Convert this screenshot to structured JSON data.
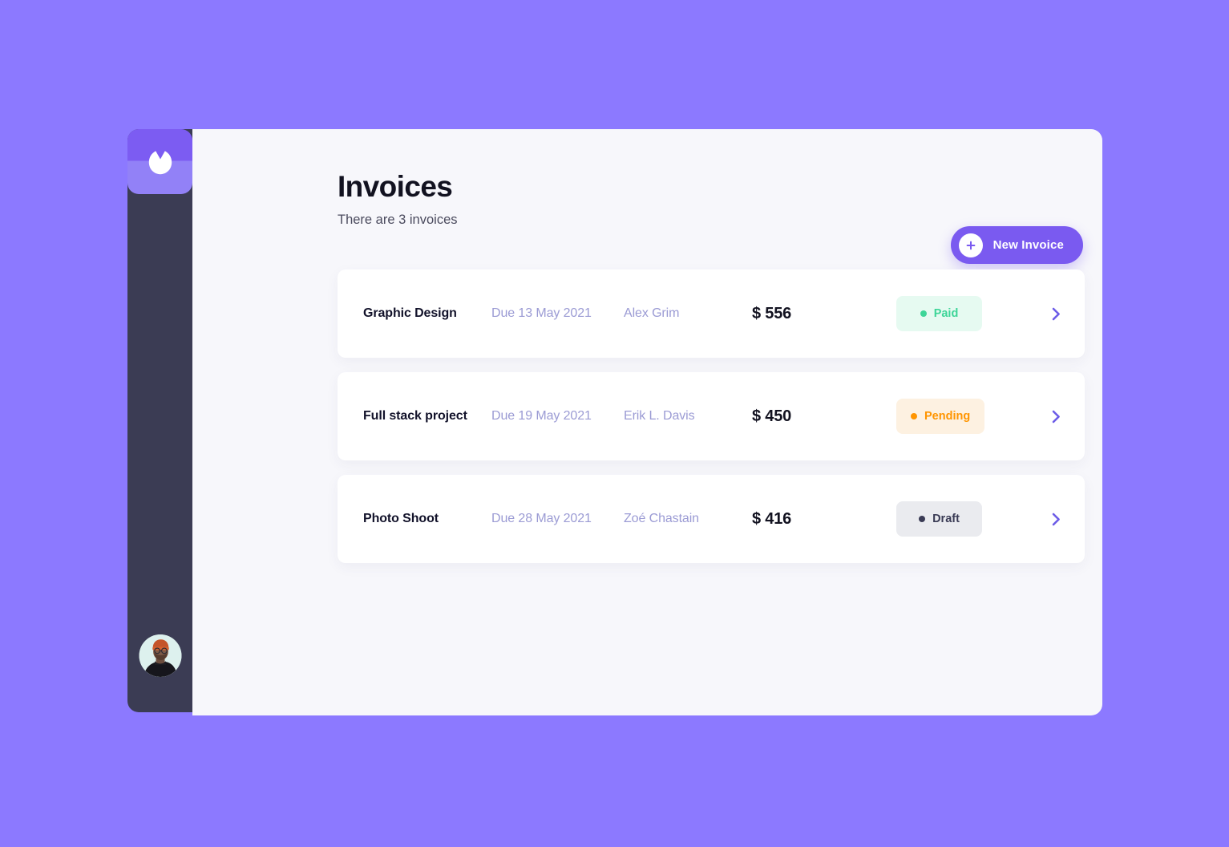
{
  "colors": {
    "background": "#8c79ff",
    "panel": "#f7f7fb",
    "sidebar": "#3b3c54",
    "accent": "#7a5af0",
    "muted_text": "#9b9bd4",
    "paid": "#3dd598",
    "pending": "#ff9500",
    "draft": "#3a3b55"
  },
  "sidebar": {
    "logo_icon": "tulip-logo-icon",
    "avatar_icon": "user-avatar"
  },
  "header": {
    "title": "Invoices",
    "subtitle": "There are 3 invoices",
    "new_invoice_label": "New Invoice",
    "plus_icon": "plus-icon"
  },
  "invoices": [
    {
      "title": "Graphic Design",
      "due": "Due 13 May 2021",
      "client": "Alex Grim",
      "amount": "$ 556",
      "status": "Paid",
      "status_key": "paid",
      "chevron_icon": "chevron-right-icon"
    },
    {
      "title": "Full stack project",
      "due": "Due 19 May 2021",
      "client": "Erik L. Davis",
      "amount": "$ 450",
      "status": "Pending",
      "status_key": "pending",
      "chevron_icon": "chevron-right-icon"
    },
    {
      "title": "Photo Shoot",
      "due": "Due 28 May 2021",
      "client": "Zoé Chastain",
      "amount": "$ 416",
      "status": "Draft",
      "status_key": "draft",
      "chevron_icon": "chevron-right-icon"
    }
  ]
}
